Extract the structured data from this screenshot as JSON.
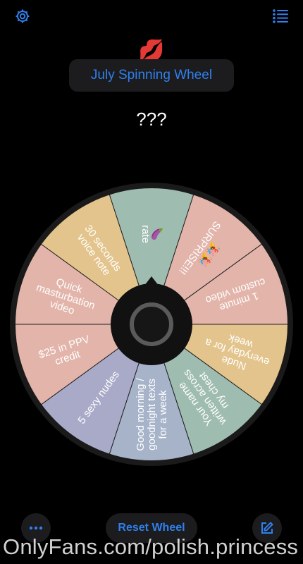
{
  "header": {
    "settings_icon": "gear-icon",
    "menu_icon": "list-icon",
    "accent_color": "#2f80ed"
  },
  "sticker": {
    "emoji": "💋"
  },
  "title": "July Spinning Wheel",
  "result": "???",
  "wheel": {
    "segments": [
      {
        "text": "🍆\nrate",
        "color": "#9fbcb0"
      },
      {
        "text": "🎉🎉\nSURPRISE!!!",
        "color": "#e2b4aa"
      },
      {
        "text": "1 minute\ncustom video",
        "color": "#e2b4aa"
      },
      {
        "text": "Nude\neveryday for a\nweek",
        "color": "#e3c48c"
      },
      {
        "text": "Your name\nwritten across\nmy chest",
        "color": "#9fbcb0"
      },
      {
        "text": "Good morning /\ngoodnight texts\nfor a week",
        "color": "#a6b3c9"
      },
      {
        "text": "5 sexy nudes",
        "color": "#a9aac8"
      },
      {
        "text": "$25 in PPV\ncredit",
        "color": "#e2b4aa"
      },
      {
        "text": "Quick\nmasturbation\nvideo",
        "color": "#e2b4aa"
      },
      {
        "text": "30 seconds\nvoice note",
        "color": "#e3c48c"
      }
    ]
  },
  "bottom_bar": {
    "more_icon": "ellipsis-icon",
    "reset_label": "Reset Wheel",
    "edit_icon": "edit-icon"
  },
  "watermark": "OnlyFans.com/polish.princess"
}
